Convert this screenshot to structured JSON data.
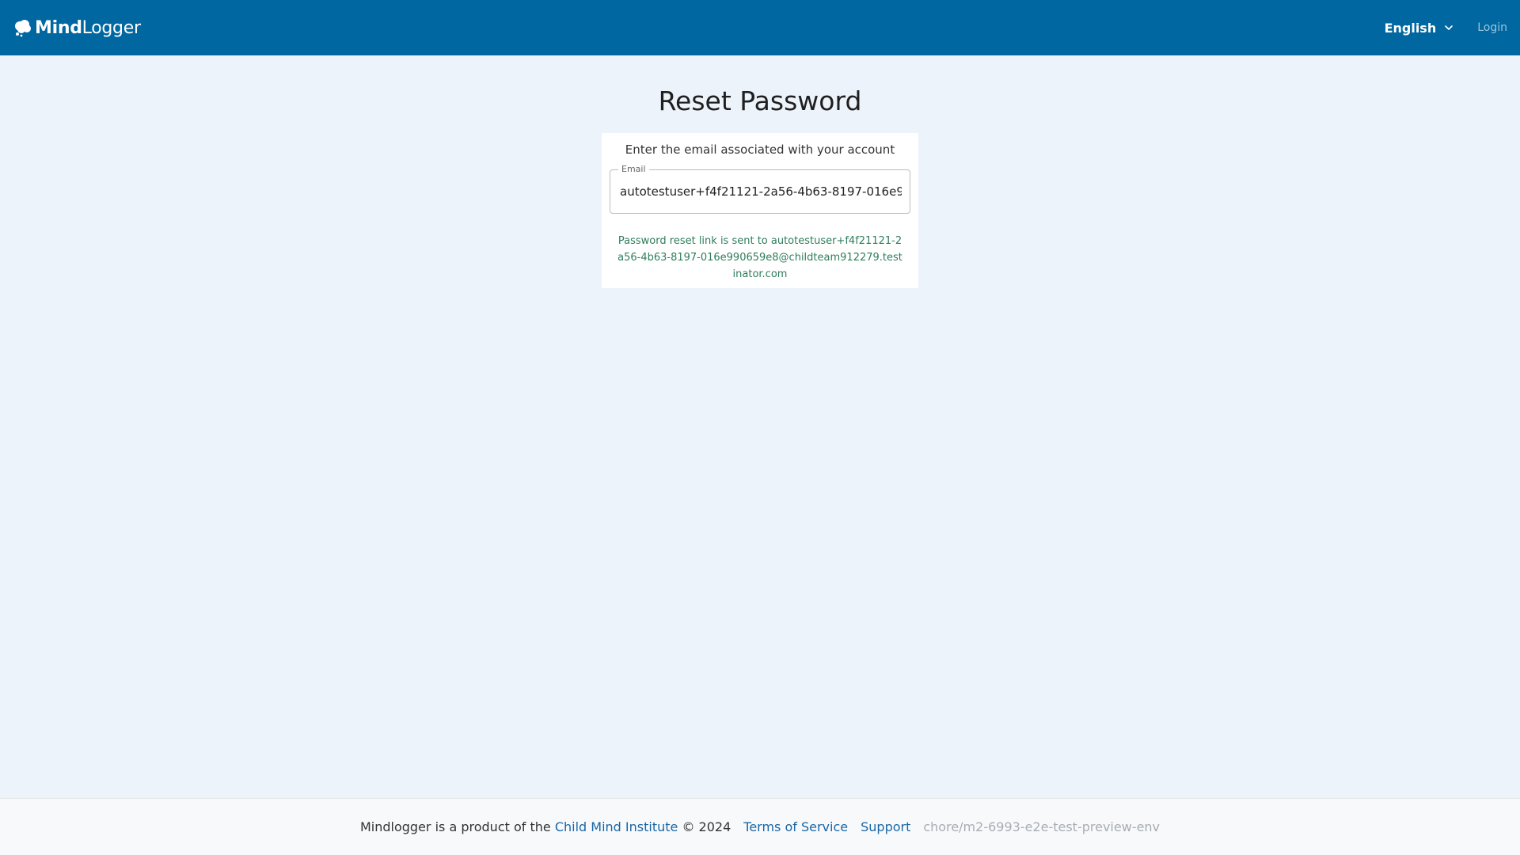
{
  "header": {
    "brand": {
      "bold": "Mind",
      "light": "Logger",
      "logo_icon": "brain-cloud-icon"
    },
    "language": {
      "selected": "English",
      "icon": "chevron-down-icon"
    },
    "login_label": "Login",
    "colors": {
      "background": "#0067a0",
      "text": "#ffffff"
    }
  },
  "main": {
    "title": "Reset Password",
    "prompt": "Enter the email associated with your account",
    "email_field": {
      "label": "Email",
      "value": "autotestuser+f4f21121-2a56-4b63-8197-016e990659e8@childteam912279.testinator.com"
    },
    "success_message": "Password reset link is sent to autotestuser+f4f21121-2a56-4b63-8197-016e990659e8@childteam912279.testinator.com",
    "colors": {
      "success": "#2e7d5b",
      "page_background": "#edf3fa"
    }
  },
  "footer": {
    "text_prefix": "Mindlogger is a product of the",
    "org_link": "Child Mind Institute",
    "copyright": "© 2024",
    "terms_link": "Terms of Service",
    "support_link": "Support",
    "env_label": "chore/m2-6993-e2e-test-preview-env"
  }
}
